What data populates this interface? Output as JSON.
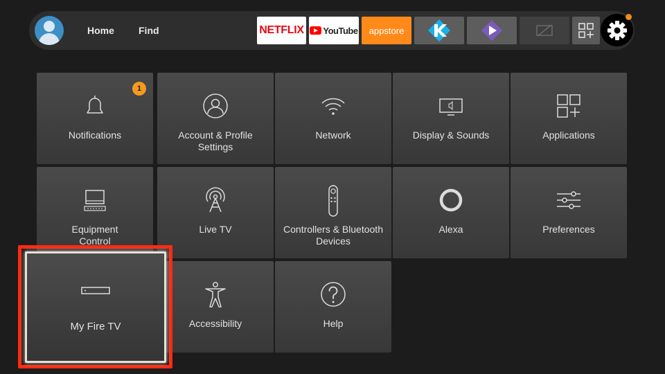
{
  "nav": {
    "home_label": "Home",
    "find_label": "Find",
    "apps": {
      "netflix": "NETFLIX",
      "youtube": "YouTube",
      "appstore": "appstore"
    }
  },
  "settings": {
    "notifications": {
      "label": "Notifications",
      "badge": "1"
    },
    "account": {
      "label": "Account & Profile Settings"
    },
    "network": {
      "label": "Network"
    },
    "display": {
      "label": "Display & Sounds"
    },
    "applications": {
      "label": "Applications"
    },
    "equipment": {
      "label": "Equipment Control"
    },
    "livetv": {
      "label": "Live TV"
    },
    "controllers": {
      "label": "Controllers & Bluetooth Devices"
    },
    "alexa": {
      "label": "Alexa"
    },
    "preferences": {
      "label": "Preferences"
    },
    "myfiretv": {
      "label": "My Fire TV"
    },
    "accessibility": {
      "label": "Accessibility"
    },
    "help": {
      "label": "Help"
    }
  },
  "colors": {
    "focus_outline": "#ff2a12",
    "badge": "#f59a1e",
    "notification_dot": "#f28b18",
    "avatar": "#3d8fc6"
  },
  "icons": [
    "profile-avatar-icon",
    "kodi-icon",
    "stremio-icon",
    "no-image-icon",
    "all-apps-grid-icon",
    "gear-icon",
    "bell-icon",
    "person-icon",
    "wifi-icon",
    "display-icon",
    "apps-grid-icon",
    "computer-icon",
    "antenna-icon",
    "remote-icon",
    "alexa-ring-icon",
    "sliders-icon",
    "fire-tv-device-icon",
    "accessibility-person-icon",
    "question-icon"
  ]
}
